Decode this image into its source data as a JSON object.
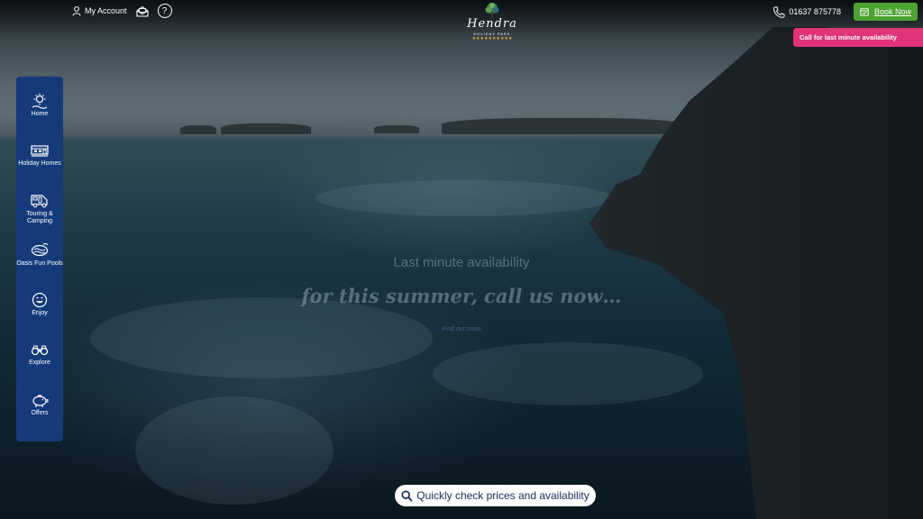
{
  "header": {
    "account_label": "My Account",
    "phone_number": "01637 875778",
    "book_label": "Book Now",
    "help_label": "?"
  },
  "logo": {
    "name": "Hendra",
    "subtitle": "HOLIDAY PARK",
    "stars": "★★★★★★★★★★"
  },
  "banner": {
    "text": "Call for last minute availability"
  },
  "sidebar": {
    "items": [
      {
        "label": "Home",
        "icon": "home-icon"
      },
      {
        "label": "Holiday Homes",
        "icon": "caravan-icon"
      },
      {
        "label": "Touring & Camping",
        "icon": "motorhome-icon"
      },
      {
        "label": "Oasis Fun Pools",
        "icon": "pool-icon"
      },
      {
        "label": "Enjoy",
        "icon": "smiley-icon"
      },
      {
        "label": "Explore",
        "icon": "binoculars-icon"
      },
      {
        "label": "Offers",
        "icon": "piggy-bank-icon"
      }
    ]
  },
  "hero": {
    "title": "Last minute availability",
    "script": "for this summer, call us now…",
    "link": "Find out more"
  },
  "search": {
    "label": "Quickly check prices and availability"
  },
  "colors": {
    "sidebar": "#143a7a",
    "book_button": "#4da331",
    "banner": "#e0337a",
    "logo_stars": "#e7a93c"
  }
}
